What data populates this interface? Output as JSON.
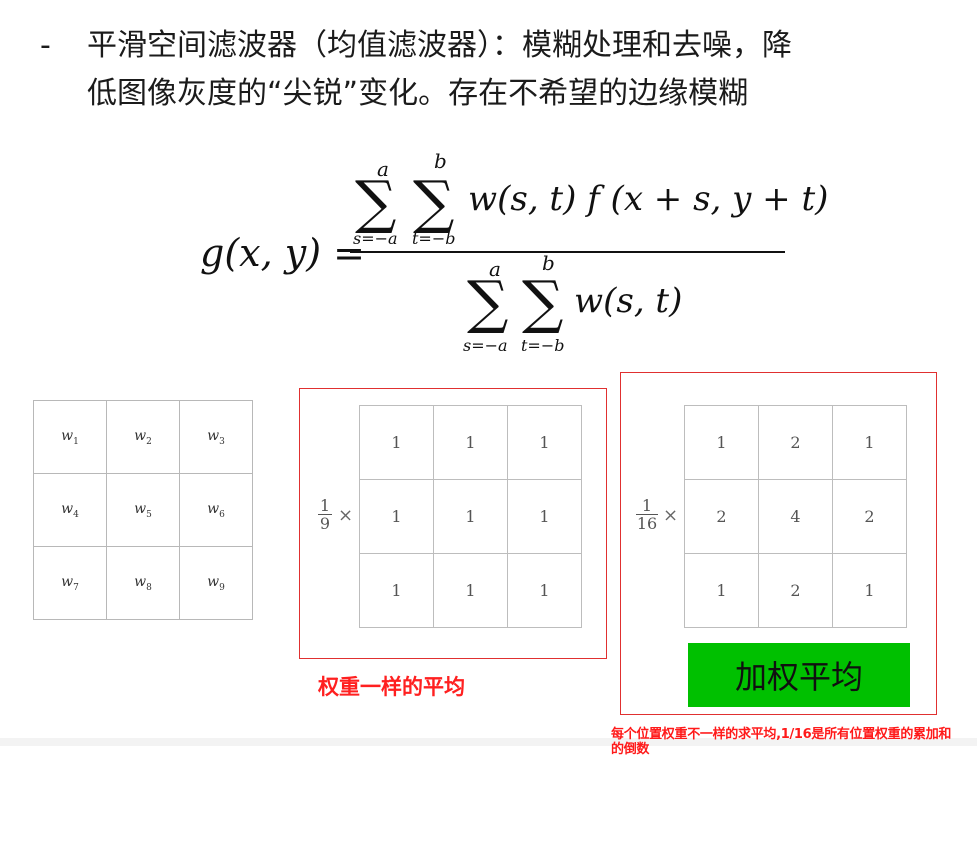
{
  "bullet": {
    "dash": "-",
    "line1": "平滑空间滤波器（均值滤波器）：模糊处理和去噪，降",
    "line2": "低图像灰度的“尖锐”变化。存在不希望的边缘模糊"
  },
  "formula": {
    "lhs": "g(x, y) =",
    "numerator_term": "w(s, t) f (x + s, y + t)",
    "denominator_term": "w(s, t)",
    "sum_upper_outer": "a",
    "sum_upper_inner": "b",
    "sum_lower_outer": "s=−a",
    "sum_lower_inner": "t=−b"
  },
  "weight_grid": {
    "cells": [
      [
        "w",
        "1"
      ],
      [
        "w",
        "2"
      ],
      [
        "w",
        "3"
      ],
      [
        "w",
        "4"
      ],
      [
        "w",
        "5"
      ],
      [
        "w",
        "6"
      ],
      [
        "w",
        "7"
      ],
      [
        "w",
        "8"
      ],
      [
        "w",
        "9"
      ]
    ]
  },
  "box_kernel": {
    "numerator": "1",
    "denominator": "9",
    "times": "×",
    "values": [
      "1",
      "1",
      "1",
      "1",
      "1",
      "1",
      "1",
      "1",
      "1"
    ]
  },
  "weighted_kernel": {
    "numerator": "1",
    "denominator": "16",
    "times": "×",
    "values": [
      "1",
      "2",
      "1",
      "2",
      "4",
      "2",
      "1",
      "2",
      "1"
    ]
  },
  "caption_box_average": "权重一样的平均",
  "weighted_average_label": "加权平均",
  "note": "每个位置权重不一样的求平均,1/16是所有位置权重的累加和的倒数",
  "colors": {
    "red": "#ff2020",
    "green": "#00c000"
  }
}
